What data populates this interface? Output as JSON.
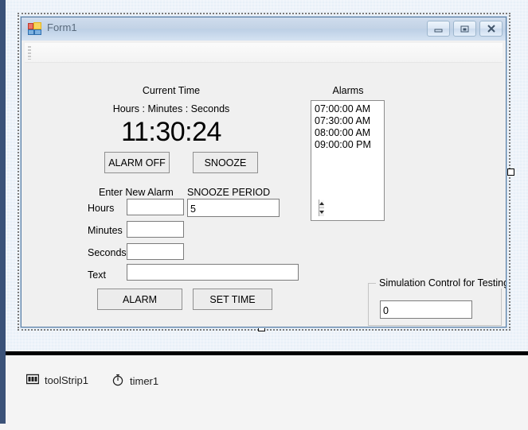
{
  "window": {
    "title": "Form1",
    "icon": "vs-form-icon",
    "buttons": [
      {
        "name": "minimize",
        "glyph": "minimize-icon"
      },
      {
        "name": "maximize",
        "glyph": "maximize-icon"
      },
      {
        "name": "close",
        "glyph": "close-icon"
      }
    ]
  },
  "form": {
    "current_time": {
      "heading": "Current Time",
      "format_label": "Hours : Minutes : Seconds",
      "value": "11:30:24"
    },
    "alarms": {
      "heading": "Alarms",
      "items": [
        "07:00:00 AM",
        "07:30:00 AM",
        "08:00:00 AM",
        "09:00:00 PM"
      ]
    },
    "top_buttons": {
      "alarm_off": "ALARM OFF",
      "snooze": "SNOOZE"
    },
    "new_alarm": {
      "heading": "Enter New Alarm",
      "hours_label": "Hours",
      "hours_value": "",
      "minutes_label": "Minutes",
      "minutes_value": "",
      "seconds_label": "Seconds",
      "seconds_value": "",
      "text_label": "Text",
      "text_value": ""
    },
    "snooze_period": {
      "heading": "SNOOZE PERIOD",
      "value": "5"
    },
    "bottom_buttons": {
      "alarm": "ALARM",
      "set_time": "SET TIME"
    },
    "simulation": {
      "group_title": "Simulation Control for Testing",
      "value": "0"
    }
  },
  "tray": {
    "items": [
      {
        "label": "toolStrip1",
        "icon": "toolstrip-icon"
      },
      {
        "label": "timer1",
        "icon": "timer-icon"
      }
    ]
  },
  "colors": {
    "form_background": "#f0f0f0",
    "designer_background": "#eef3fa",
    "left_rail": "#3b5278",
    "titlebar_accent": "#c3d3e6",
    "selection_border": "#7a7a7a"
  }
}
